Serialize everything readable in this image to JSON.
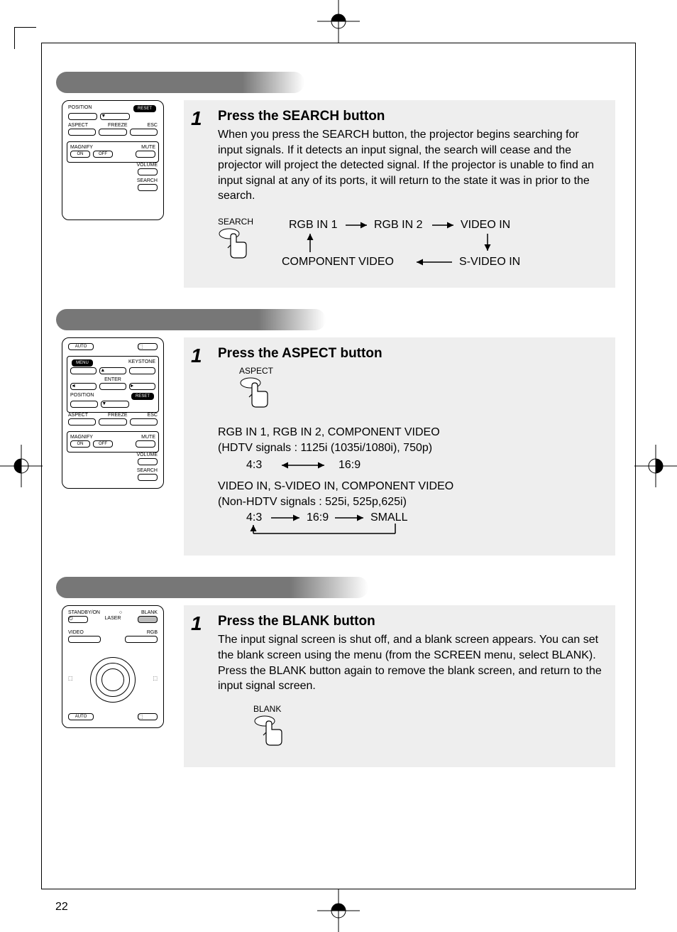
{
  "page_number": "22",
  "sections": [
    {
      "step": "1",
      "heading": "Press the SEARCH button",
      "body": "When you press the SEARCH button, the projector begins searching for input signals. If it detects an input signal, the search will cease and the projector will project the detected signal. If the projector is unable to find an input signal at any of its ports, it will return to the state it was in prior to the search.",
      "press_label": "SEARCH",
      "flow": {
        "top_left": "RGB IN 1",
        "top_mid": "RGB IN 2",
        "top_right": "VIDEO IN",
        "bot_right": "S-VIDEO IN",
        "bot_left": "COMPONENT VIDEO"
      }
    },
    {
      "step": "1",
      "heading": "Press the ASPECT button",
      "press_label": "ASPECT",
      "line1": "RGB IN 1, RGB IN 2, COMPONENT VIDEO",
      "line2": "(HDTV signals : 1125i (1035i/1080i), 750p)",
      "ratio_a": "4:3",
      "ratio_b": "16:9",
      "line3": "VIDEO IN, S-VIDEO IN, COMPONENT VIDEO",
      "line4": "(Non-HDTV signals : 525i, 525p,625i)",
      "seq_a": "4:3",
      "seq_b": "16:9",
      "seq_c": "SMALL"
    },
    {
      "step": "1",
      "heading": "Press the BLANK button",
      "body": "The input signal screen is shut off, and a blank screen appears. You can set the blank screen using the menu (from the SCREEN menu, select BLANK). Press the BLANK button again to remove the blank screen, and return to the input signal screen.",
      "press_label": "BLANK"
    }
  ],
  "remote_labels": {
    "position": "POSITION",
    "reset": "RESET",
    "aspect": "ASPECT",
    "freeze": "FREEZE",
    "esc": "ESC",
    "magnify": "MAGNIFY",
    "mute": "MUTE",
    "on": "ON",
    "off": "OFF",
    "volume": "VOLUME",
    "search": "SEARCH",
    "auto": "AUTO",
    "menu": "MENU",
    "keystone": "KEYSTONE",
    "enter": "ENTER",
    "standby": "STANDBY/ON",
    "blank": "BLANK",
    "laser": "LASER",
    "video": "VIDEO",
    "rgb": "RGB"
  }
}
